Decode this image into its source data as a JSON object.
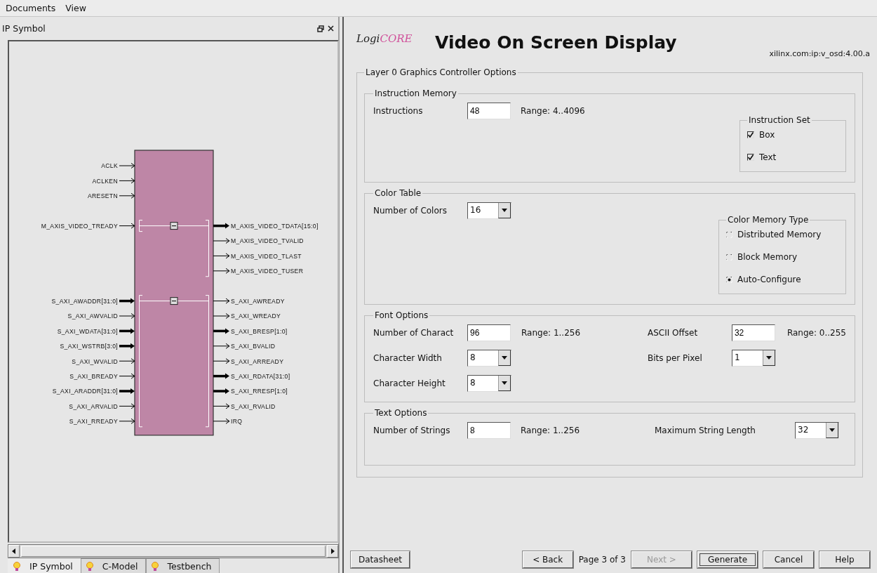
{
  "menu": [
    {
      "label": "Documents"
    },
    {
      "label": "View"
    }
  ],
  "left_pane": {
    "title": "IP Symbol",
    "symbol": {
      "ports": [
        {
          "name": "ACLK",
          "bus": false
        },
        {
          "name": "ACLKEN",
          "bus": false
        },
        {
          "name": "ARESETN",
          "bus": false
        }
      ],
      "interfaces": [
        {
          "expanded": true,
          "inputs": [
            {
              "name": "M_AXIS_VIDEO_TREADY",
              "bus": false
            }
          ],
          "outputs": [
            {
              "name": "M_AXIS_VIDEO_TDATA[15:0]",
              "bus": true
            },
            {
              "name": "M_AXIS_VIDEO_TVALID",
              "bus": false
            },
            {
              "name": "M_AXIS_VIDEO_TLAST",
              "bus": false
            },
            {
              "name": "M_AXIS_VIDEO_TUSER",
              "bus": false
            }
          ]
        },
        {
          "expanded": true,
          "inputs": [
            {
              "name": "S_AXI_AWADDR[31:0]",
              "bus": true
            },
            {
              "name": "S_AXI_AWVALID",
              "bus": false
            },
            {
              "name": "S_AXI_WDATA[31:0]",
              "bus": true
            },
            {
              "name": "S_AXI_WSTRB[3:0]",
              "bus": true
            },
            {
              "name": "S_AXI_WVALID",
              "bus": false
            },
            {
              "name": "S_AXI_BREADY",
              "bus": false
            },
            {
              "name": "S_AXI_ARADDR[31:0]",
              "bus": true
            },
            {
              "name": "S_AXI_ARVALID",
              "bus": false
            },
            {
              "name": "S_AXI_RREADY",
              "bus": false
            }
          ],
          "outputs": [
            {
              "name": "S_AXI_AWREADY",
              "bus": false
            },
            {
              "name": "S_AXI_WREADY",
              "bus": false
            },
            {
              "name": "S_AXI_BRESP[1:0]",
              "bus": true
            },
            {
              "name": "S_AXI_BVALID",
              "bus": false
            },
            {
              "name": "S_AXI_ARREADY",
              "bus": false
            },
            {
              "name": "S_AXI_RDATA[31:0]",
              "bus": true
            },
            {
              "name": "S_AXI_RRESP[1:0]",
              "bus": true
            },
            {
              "name": "S_AXI_RVALID",
              "bus": false
            },
            {
              "name": "IRQ",
              "bus": false
            }
          ]
        }
      ]
    },
    "tabs": [
      {
        "label": "IP Symbol",
        "selected": true
      },
      {
        "label": "C-Model",
        "selected": false
      },
      {
        "label": "Testbench",
        "selected": false
      }
    ]
  },
  "header": {
    "logo": [
      "Logi",
      "CORE"
    ],
    "title": "Video On Screen Display",
    "version": "xilinx.com:ip:v_osd:4.00.a"
  },
  "options": {
    "title": "Layer 0 Graphics Controller Options",
    "sections": [
      {
        "title": "Instruction Memory",
        "columns": [
          [
            {
              "label": "Instructions",
              "control": {
                "kind": "text",
                "value": "48"
              },
              "range": "Range: 4..4096"
            }
          ]
        ],
        "group": {
          "title": "Instruction Set",
          "options": [
            {
              "kind": "checkbox",
              "label": "Box",
              "checked": true
            },
            {
              "kind": "checkbox",
              "label": "Text",
              "checked": true
            }
          ]
        }
      },
      {
        "title": "Color Table",
        "columns": [
          [
            {
              "label": "Number of Colors",
              "control": {
                "kind": "select",
                "value": "16"
              }
            }
          ]
        ],
        "group": {
          "title": "Color Memory Type",
          "options": [
            {
              "kind": "radio",
              "label": "Distributed Memory",
              "selected": false
            },
            {
              "kind": "radio",
              "label": "Block Memory",
              "selected": false
            },
            {
              "kind": "radio",
              "label": "Auto-Configure",
              "selected": true
            }
          ]
        }
      },
      {
        "title": "Font Options",
        "columns": [
          [
            {
              "label": "Number of Charact",
              "control": {
                "kind": "text",
                "value": "96"
              },
              "range": "Range: 1..256"
            },
            {
              "label": "Character Width",
              "control": {
                "kind": "select",
                "value": "8"
              }
            },
            {
              "label": "Character Height",
              "control": {
                "kind": "select",
                "value": "8"
              }
            }
          ],
          [
            {
              "label": "ASCII Offset",
              "control": {
                "kind": "text",
                "value": "32"
              },
              "range": "Range: 0..255"
            },
            {
              "label": "Bits per Pixel",
              "control": {
                "kind": "select",
                "value": "1"
              }
            }
          ]
        ]
      },
      {
        "title": "Text Options",
        "columns": [
          [
            {
              "label": "Number of Strings",
              "control": {
                "kind": "text",
                "value": "8"
              },
              "range": "Range: 1..256"
            }
          ],
          [
            {
              "label": "Maximum String Length",
              "control": {
                "kind": "select",
                "value": "32"
              }
            }
          ]
        ]
      }
    ]
  },
  "footer": {
    "left": [
      {
        "kind": "button",
        "label": "Datasheet",
        "disabled": false,
        "focused": false
      }
    ],
    "right": [
      {
        "kind": "button",
        "label": "< Back",
        "disabled": false,
        "focused": false
      },
      {
        "kind": "text",
        "label": "Page 3 of 3"
      },
      {
        "kind": "button",
        "label": "Next >",
        "disabled": true,
        "focused": false
      },
      {
        "kind": "button",
        "label": "Generate",
        "disabled": false,
        "focused": true
      },
      {
        "kind": "button",
        "label": "Cancel",
        "disabled": false,
        "focused": false
      },
      {
        "kind": "button",
        "label": "Help",
        "disabled": false,
        "focused": false
      }
    ]
  }
}
